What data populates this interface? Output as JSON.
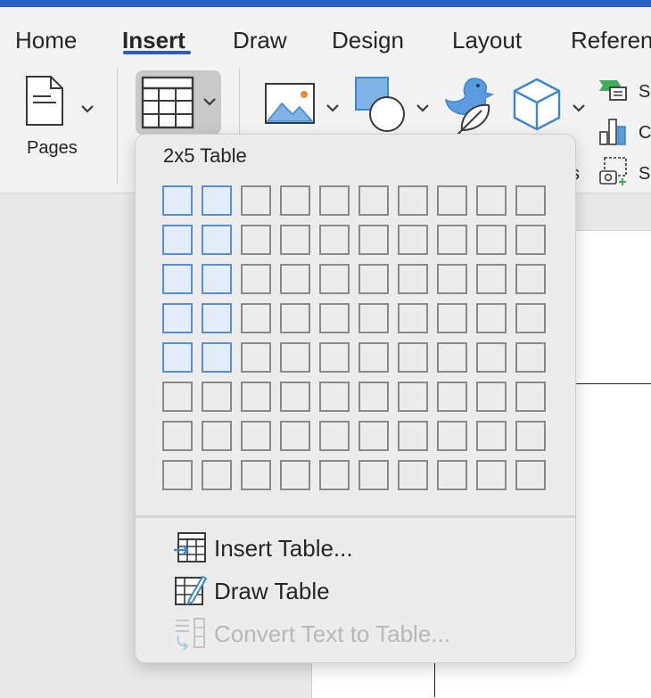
{
  "ribbon": {
    "tabs": [
      "Home",
      "Insert",
      "Draw",
      "Design",
      "Layout",
      "Referen"
    ],
    "active_tab": "Insert",
    "pages_label": "Pages",
    "side_items": [
      "S",
      "C",
      "S"
    ],
    "partial_label": "s"
  },
  "table_menu": {
    "grid_title": "2x5 Table",
    "grid_columns": 10,
    "grid_rows": 8,
    "selected_columns": 2,
    "selected_rows": 5,
    "items": [
      {
        "label": "Insert Table...",
        "icon": "insert-table-icon",
        "enabled": true
      },
      {
        "label": "Draw Table",
        "icon": "draw-table-icon",
        "enabled": true
      },
      {
        "label": "Convert Text to Table...",
        "icon": "convert-text-to-table-icon",
        "enabled": false
      }
    ]
  },
  "colors": {
    "accent": "#2b5fbf",
    "selected_cell_border": "#5b8fd4",
    "selected_cell_fill": "#e4eefb",
    "icon_blue": "#3b87d4",
    "disabled_text": "#b8b8b8"
  }
}
